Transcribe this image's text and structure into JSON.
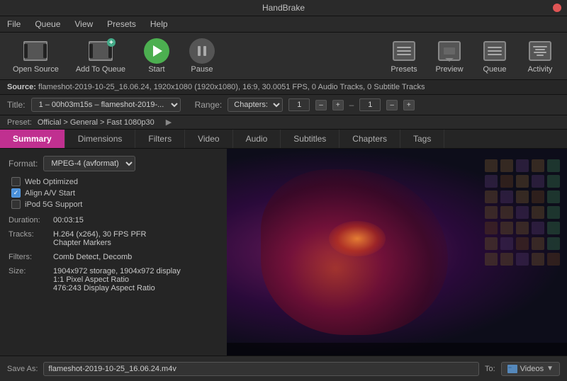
{
  "app": {
    "title": "HandBrake"
  },
  "menu": {
    "items": [
      "File",
      "Queue",
      "View",
      "Presets",
      "Help"
    ]
  },
  "toolbar": {
    "buttons": [
      {
        "id": "open-source",
        "label": "Open Source",
        "icon": "filmstrip"
      },
      {
        "id": "add-to-queue",
        "label": "Add To Queue",
        "icon": "queue"
      },
      {
        "id": "start",
        "label": "Start",
        "icon": "play"
      },
      {
        "id": "pause",
        "label": "Pause",
        "icon": "pause"
      },
      {
        "id": "presets",
        "label": "Presets",
        "icon": "presets"
      },
      {
        "id": "preview",
        "label": "Preview",
        "icon": "preview"
      },
      {
        "id": "queue",
        "label": "Queue",
        "icon": "queue2"
      },
      {
        "id": "activity",
        "label": "Activity",
        "icon": "activity"
      }
    ]
  },
  "source_bar": {
    "prefix": "Source:",
    "text": "flameshot-2019-10-25_16.06.24, 1920x1080 (1920x1080), 16:9, 30.0051 FPS, 0 Audio Tracks, 0 Subtitle Tracks"
  },
  "title_row": {
    "label": "Title:",
    "title_value": "1 – 00h03m15s – flameshot-2019-...",
    "range_label": "Range:",
    "range_value": "Chapters:",
    "start_num": "1",
    "end_num": "1"
  },
  "preset_row": {
    "label": "Preset:",
    "value": "Official > General > Fast 1080p30"
  },
  "tabs": {
    "items": [
      "Summary",
      "Dimensions",
      "Filters",
      "Video",
      "Audio",
      "Subtitles",
      "Chapters",
      "Tags"
    ],
    "active": "Summary"
  },
  "summary": {
    "format_label": "Format:",
    "format_value": "MPEG-4 (avformat)",
    "checkboxes": [
      {
        "label": "Web Optimized",
        "checked": false
      },
      {
        "label": "Align A/V Start",
        "checked": true
      },
      {
        "label": "iPod 5G Support",
        "checked": false
      }
    ],
    "duration_label": "Duration:",
    "duration_value": "00:03:15",
    "tracks_label": "Tracks:",
    "tracks_lines": [
      "H.264 (x264), 30 FPS PFR",
      "Chapter Markers"
    ],
    "filters_label": "Filters:",
    "filters_value": "Comb Detect, Decomb",
    "size_label": "Size:",
    "size_lines": [
      "1904x972 storage, 1904x972 display",
      "1:1 Pixel Aspect Ratio",
      "476:243 Display Aspect Ratio"
    ]
  },
  "bottom_bar": {
    "save_label": "Save As:",
    "save_value": "flameshot-2019-10-25_16.06.24.m4v",
    "to_label": "To:",
    "dest_label": "Videos"
  }
}
